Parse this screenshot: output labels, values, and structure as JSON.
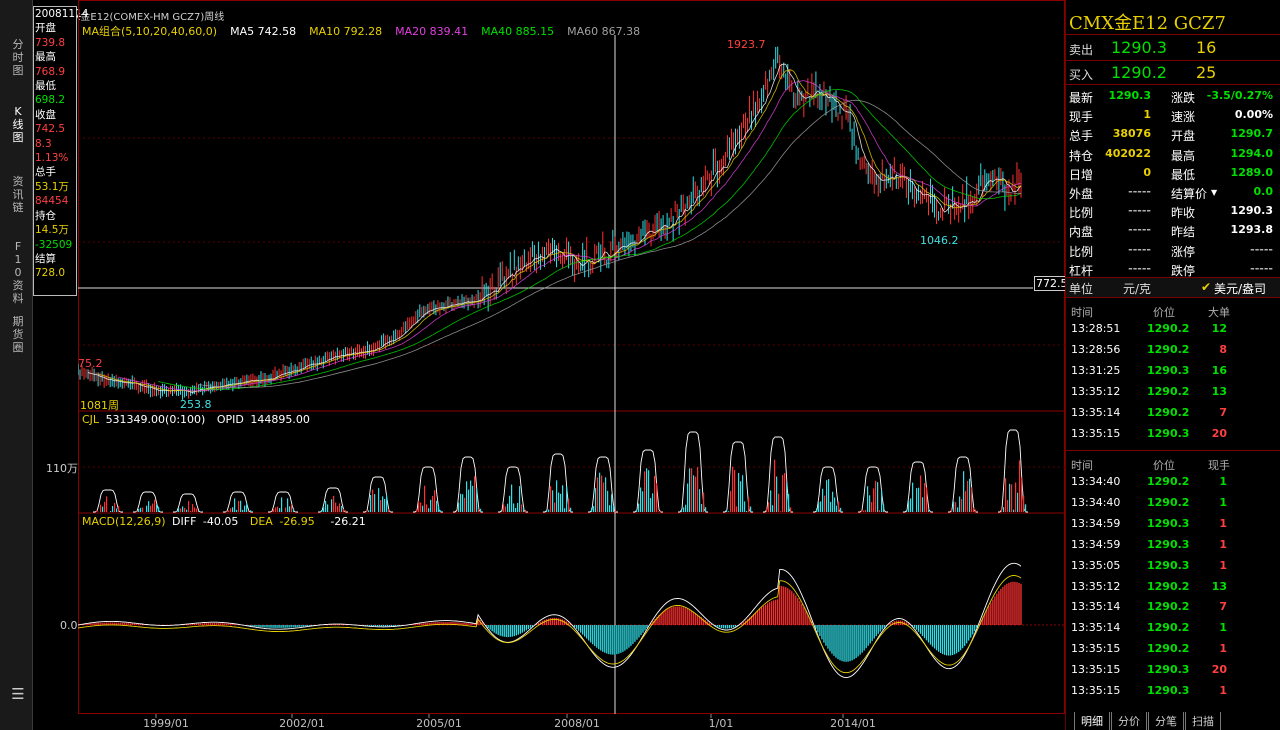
{
  "window": {
    "title": "CMX金E12(COMEX-HM GCZ7)周线",
    "title_icon": "link-icon"
  },
  "left_tabs": [
    {
      "label": "分时图",
      "active": false
    },
    {
      "label": "K线图",
      "active": true
    },
    {
      "label": "资讯链",
      "active": false
    },
    {
      "label": "F10资料",
      "active": false
    },
    {
      "label": "期货圈",
      "active": false
    }
  ],
  "left_menu_icon": "list-icon",
  "info": [
    {
      "label": "20081114",
      "value": ""
    },
    {
      "label": "开盘",
      "value": "739.8",
      "color": "red"
    },
    {
      "label": "最高",
      "value": "768.9",
      "color": "red"
    },
    {
      "label": "最低",
      "value": "698.2",
      "color": "green"
    },
    {
      "label": "收盘",
      "value": "742.5",
      "color": "red"
    },
    {
      "label": "",
      "value": "8.3",
      "color": "red"
    },
    {
      "label": "",
      "value": "1.13%",
      "color": "red"
    },
    {
      "label": "总手",
      "value": "53.1万",
      "color": "yellow"
    },
    {
      "label": "",
      "value": "84454",
      "color": "red"
    },
    {
      "label": "持仓",
      "value": "14.5万",
      "color": "yellow"
    },
    {
      "label": "",
      "value": "-32509",
      "color": "green"
    },
    {
      "label": "结算",
      "value": "728.0",
      "color": "yellow"
    }
  ],
  "ma_legend": [
    {
      "text": "MA组合(5,10,20,40,60,0)",
      "color": "#e8d000"
    },
    {
      "text": "MA5 742.58",
      "color": "#ffffff"
    },
    {
      "text": "MA10 792.28",
      "color": "#e8d000"
    },
    {
      "text": "MA20 839.41",
      "color": "#e040e0"
    },
    {
      "text": "MA40 885.15",
      "color": "#00e000"
    },
    {
      "text": "MA60 867.38",
      "color": "#a0a0a0"
    }
  ],
  "price_labels": {
    "high": "1923.7",
    "low_left": "253.8",
    "low_right": "1046.2",
    "left_edge": "75.2",
    "crosshair_value": "772.5",
    "period_count": "1081周"
  },
  "volume_legend": {
    "name": "CJL",
    "value": "531349.00(0:100)",
    "opid_label": "OPID",
    "opid_value": "144895.00"
  },
  "volume_axis": "110万",
  "macd_legend": {
    "name": "MACD(12,26,9)",
    "diff_label": "DIFF",
    "diff": "-40.05",
    "dea_label": "DEA",
    "dea": "-26.95",
    "macd": "-26.21"
  },
  "macd_axis": "0.0",
  "x_axis": [
    "1999/01",
    "2002/01",
    "2005/01",
    "2008/01",
    "1/01",
    "2014/01"
  ],
  "quote": {
    "title": "CMX金E12  GCZ7",
    "sell_label": "卖出",
    "sell_price": "1290.3",
    "sell_vol": "16",
    "buy_label": "买入",
    "buy_price": "1290.2",
    "buy_vol": "25",
    "rows": [
      {
        "l1": "最新",
        "v1": "1290.3",
        "c1": "green",
        "l2": "涨跌",
        "v2": "-3.5/0.27%",
        "c2": "green"
      },
      {
        "l1": "现手",
        "v1": "1",
        "c1": "yellow",
        "l2": "速涨",
        "v2": "0.00%",
        "c2": "white"
      },
      {
        "l1": "总手",
        "v1": "38076",
        "c1": "yellow",
        "l2": "开盘",
        "v2": "1290.7",
        "c2": "green"
      },
      {
        "l1": "持仓",
        "v1": "402022",
        "c1": "yellow",
        "l2": "最高",
        "v2": "1294.0",
        "c2": "green"
      },
      {
        "l1": "日增",
        "v1": "0",
        "c1": "yellow",
        "l2": "最低",
        "v2": "1289.0",
        "c2": "green"
      },
      {
        "l1": "外盘",
        "v1": "-----",
        "c1": "gray",
        "l2": "结算价",
        "v2": "0.0",
        "c2": "green"
      },
      {
        "l1": "比例",
        "v1": "-----",
        "c1": "gray",
        "l2": "昨收",
        "v2": "1290.3",
        "c2": "white"
      },
      {
        "l1": "内盘",
        "v1": "-----",
        "c1": "gray",
        "l2": "昨结",
        "v2": "1293.8",
        "c2": "white"
      },
      {
        "l1": "比例",
        "v1": "-----",
        "c1": "gray",
        "l2": "涨停",
        "v2": "-----",
        "c2": "gray"
      },
      {
        "l1": "杠杆",
        "v1": "-----",
        "c1": "gray",
        "l2": "跌停",
        "v2": "-----",
        "c2": "gray"
      }
    ],
    "unit_label": "单位",
    "unit_a": "元/克",
    "unit_b": "美元/盎司"
  },
  "big_trades": {
    "headers": [
      "时间",
      "价位",
      "大单"
    ],
    "rows": [
      {
        "t": "13:28:51",
        "p": "1290.2",
        "v": "12",
        "vc": "green"
      },
      {
        "t": "13:28:56",
        "p": "1290.2",
        "v": "8",
        "vc": "red"
      },
      {
        "t": "13:31:25",
        "p": "1290.3",
        "v": "16",
        "vc": "green"
      },
      {
        "t": "13:35:12",
        "p": "1290.2",
        "v": "13",
        "vc": "green"
      },
      {
        "t": "13:35:14",
        "p": "1290.2",
        "v": "7",
        "vc": "red"
      },
      {
        "t": "13:35:15",
        "p": "1290.3",
        "v": "20",
        "vc": "red"
      }
    ]
  },
  "ticks": {
    "headers": [
      "时间",
      "价位",
      "现手"
    ],
    "rows": [
      {
        "t": "13:34:40",
        "p": "1290.2",
        "v": "1",
        "vc": "green"
      },
      {
        "t": "13:34:40",
        "p": "1290.2",
        "v": "1",
        "vc": "green"
      },
      {
        "t": "13:34:59",
        "p": "1290.3",
        "v": "1",
        "vc": "red"
      },
      {
        "t": "13:34:59",
        "p": "1290.3",
        "v": "1",
        "vc": "red"
      },
      {
        "t": "13:35:05",
        "p": "1290.3",
        "v": "1",
        "vc": "red"
      },
      {
        "t": "13:35:12",
        "p": "1290.2",
        "v": "13",
        "vc": "green"
      },
      {
        "t": "13:35:14",
        "p": "1290.2",
        "v": "7",
        "vc": "red"
      },
      {
        "t": "13:35:14",
        "p": "1290.2",
        "v": "1",
        "vc": "green"
      },
      {
        "t": "13:35:15",
        "p": "1290.2",
        "v": "1",
        "vc": "red"
      },
      {
        "t": "13:35:15",
        "p": "1290.3",
        "v": "20",
        "vc": "red"
      },
      {
        "t": "13:35:15",
        "p": "1290.3",
        "v": "1",
        "vc": "red"
      }
    ]
  },
  "bottom_tabs": [
    "明细",
    "分价",
    "分笔",
    "扫描"
  ],
  "colors": {
    "up": "#ff3030",
    "down": "#30e0e8",
    "frame": "#8a0000",
    "grid": "#5a0000"
  }
}
